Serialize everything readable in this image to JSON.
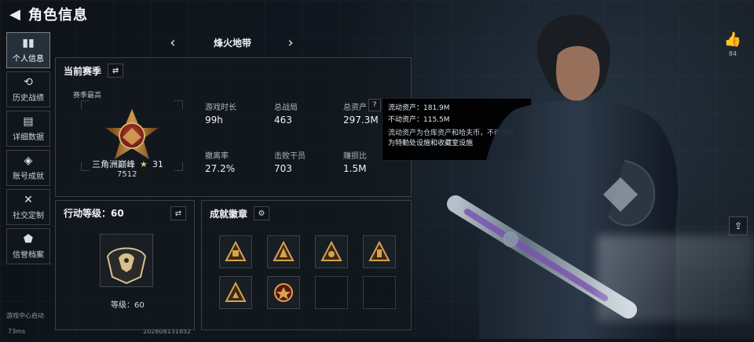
{
  "header": {
    "title": "角色信息"
  },
  "sidebar": {
    "items": [
      {
        "label": "个人信息",
        "icon": "chart-icon"
      },
      {
        "label": "历史战绩",
        "icon": "history-icon"
      },
      {
        "label": "详细数据",
        "icon": "folder-icon"
      },
      {
        "label": "账号成就",
        "icon": "trophy-icon"
      },
      {
        "label": "社交定制",
        "icon": "tools-icon"
      },
      {
        "label": "信誉档案",
        "icon": "shield-icon"
      }
    ],
    "footer_tag": "游戏中心启动"
  },
  "mode": {
    "title": "烽火地带"
  },
  "season": {
    "title": "当前赛季",
    "highest_label": "赛季最高",
    "rank_name": "三角洲巅峰",
    "rank_star_count": "31",
    "rank_points": "7512",
    "stats": {
      "playtime_label": "游戏时长",
      "playtime_value": "99h",
      "matches_label": "总战局",
      "matches_value": "463",
      "assets_label": "总资产",
      "assets_value": "297.3M",
      "extraction_label": "撤离率",
      "extraction_value": "27.2%",
      "kills_label": "击败干员",
      "kills_value": "703",
      "profit_label": "赚损比",
      "profit_value": "1.5M"
    }
  },
  "tooltip": {
    "liquid": "流动资产：181.9M",
    "fixed": "不动资产：115.5M",
    "desc_line1": "流动资产为仓库资产和哈夫币，不动资产",
    "desc_line2": "为特勤处设施和收藏室设施"
  },
  "level_panel": {
    "title": "行动等级：60",
    "level_text": "等级：60"
  },
  "achievements": {
    "title": "成就徽章"
  },
  "right": {
    "likes": "84"
  },
  "status": {
    "ping": "73ms",
    "id": "202608131852"
  }
}
